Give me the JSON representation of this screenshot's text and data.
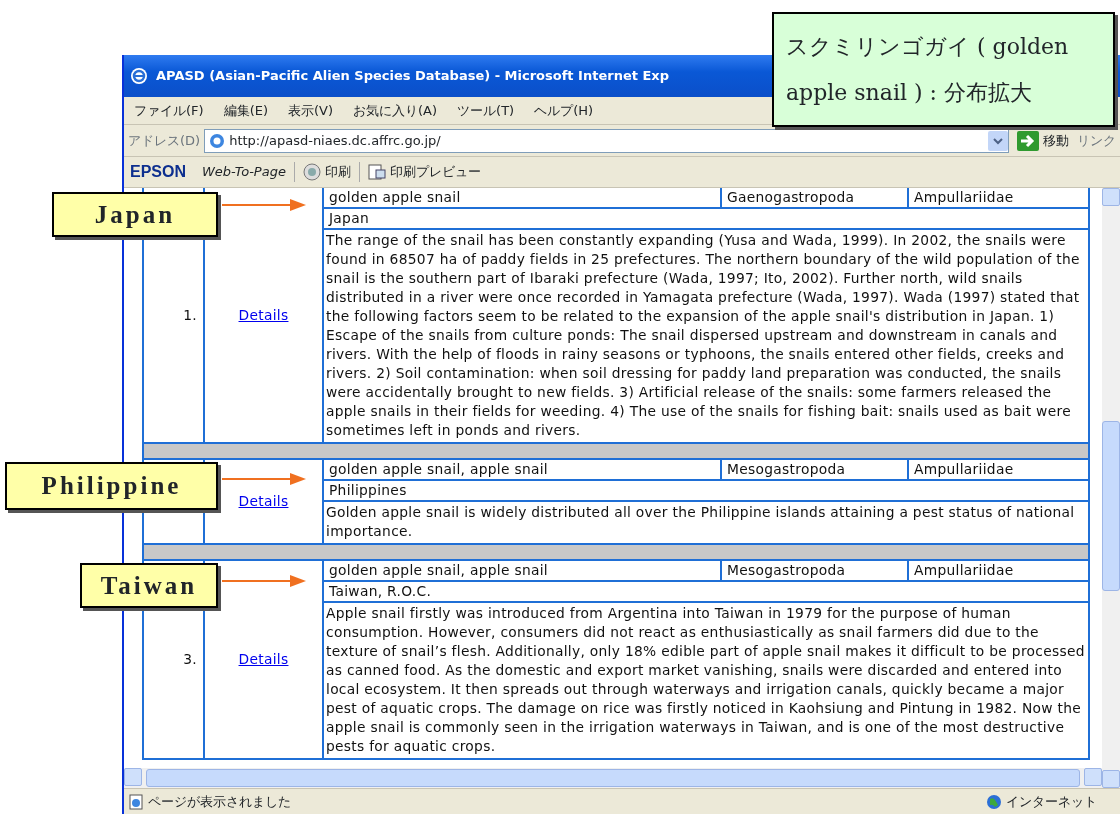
{
  "callouts": [
    {
      "kind": "title",
      "text": "スクミリンゴガイ ( golden apple snail ) : 分布拡大"
    },
    {
      "kind": "label",
      "text": "Japan"
    },
    {
      "kind": "label",
      "text": "Philippine"
    },
    {
      "kind": "label",
      "text": "Taiwan"
    }
  ],
  "window": {
    "title": "APASD (Asian-Pacific Alien Species Database) - Microsoft Internet Exp"
  },
  "menu": [
    "ファイル(F)",
    "編集(E)",
    "表示(V)",
    "お気に入り(A)",
    "ツール(T)",
    "ヘルプ(H)"
  ],
  "address_bar": {
    "label": "アドレス(D)",
    "url": "http://apasd-niaes.dc.affrc.go.jp/",
    "go_button": "移動",
    "links_label": "リンク"
  },
  "toolbar": {
    "brand": "EPSON",
    "web_to_page": "Web-To-Page",
    "print": "印刷",
    "print_preview": "印刷プレビュー"
  },
  "records": [
    {
      "number": "1.",
      "link": "Details",
      "name": "golden apple snail",
      "order": "Gaenogastropoda",
      "family": "Ampullariidae",
      "country": "Japan",
      "description": "The range of the snail has been constantly expanding (Yusa and Wada, 1999). In 2002, the snails were found in 68507 ha of paddy fields in 25 prefectures. The northern boundary of the wild population of the snail is the southern part of Ibaraki prefecture (Wada, 1997; Ito, 2002). Further north, wild snails distributed in a river were once recorded in Yamagata prefecture (Wada, 1997). Wada (1997) stated that the following factors seem to be related to the expansion of the apple snail's distribution in Japan. 1) Escape of the snails from culture ponds: The snail dispersed upstream and downstream in canals and rivers. With the help of floods in rainy seasons or typhoons, the snails entered other fields, creeks and rivers. 2) Soil contamination: when soil dressing for paddy land preparation was conducted, the snails were accidentally brought to new fields. 3) Artificial release of the snails: some farmers released the apple snails in their fields for weeding. 4) The use of the snails for fishing bait: snails used as bait were sometimes left in ponds and rivers."
    },
    {
      "link": "Details",
      "name": "golden apple snail, apple snail",
      "order": "Mesogastropoda",
      "family": "Ampullariidae",
      "country": "Philippines",
      "description": "Golden apple snail is widely distributed all over the Philippine islands attaining a pest status of national importance."
    },
    {
      "number": "3.",
      "link": "Details",
      "name": "golden apple snail, apple snail",
      "order": "Mesogastropoda",
      "family": "Ampullariidae",
      "country": "Taiwan, R.O.C.",
      "description": "Apple snail firstly was introduced from Argentina into Taiwan in 1979 for the purpose of human consumption. However, consumers did not react as enthusiastically as snail farmers did due to the texture of snail’s flesh. Additionally, only 18% edible part of apple snail makes it difficult to be processed as canned food. As the domestic and export market vanishing, snails were discarded and entered into local ecosystem. It then spreads out through waterways and irrigation canals, quickly became a major pest of aquatic crops. The damage on rice was firstly noticed in Kaohsiung and Pintung in 1982. Now the apple snail is commonly seen in the irrigation waterways in Taiwan, and is one of the most destructive pests for aquatic crops."
    }
  ],
  "status_bar": {
    "text": "ページが表示されました",
    "zone": "インターネット"
  }
}
